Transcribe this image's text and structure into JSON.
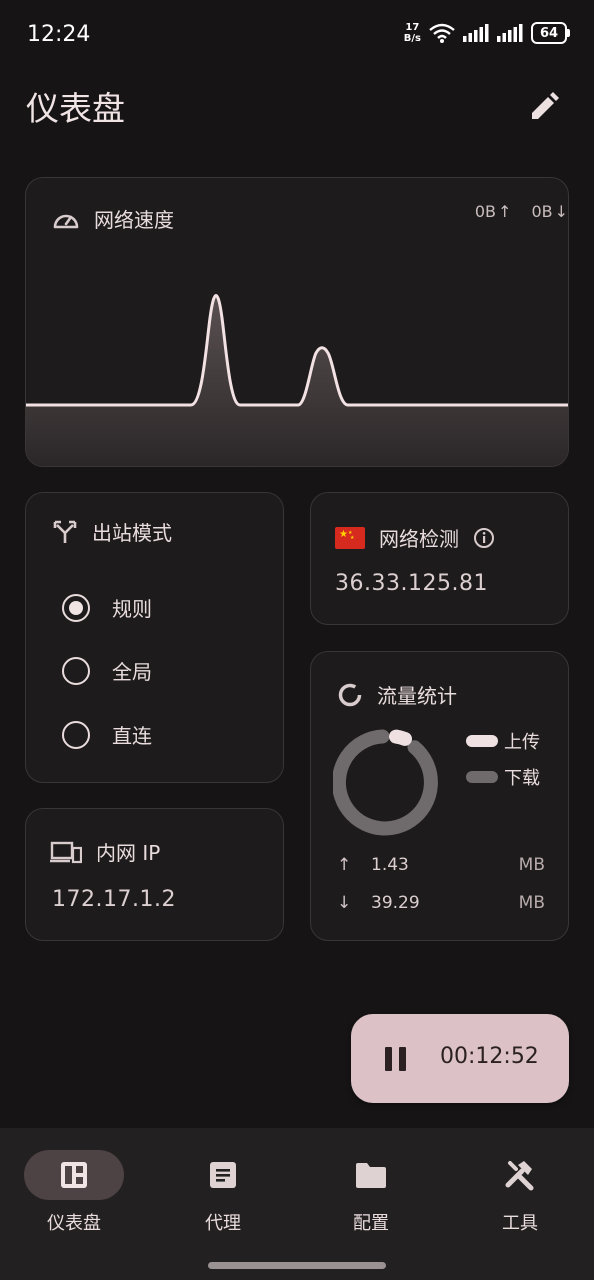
{
  "status_bar": {
    "time": "12:24",
    "net_speed_value": "17",
    "net_speed_unit": "B/s",
    "battery": "64"
  },
  "header": {
    "title": "仪表盘",
    "edit_icon": "pencil-icon"
  },
  "network_speed": {
    "title": "网络速度",
    "upload": "0B",
    "download": "0B",
    "icon": "speedometer-icon"
  },
  "outbound_mode": {
    "title": "出站模式",
    "icon": "fork-icon",
    "options": [
      {
        "label": "规则",
        "selected": true
      },
      {
        "label": "全局",
        "selected": false
      },
      {
        "label": "直连",
        "selected": false
      }
    ]
  },
  "network_check": {
    "title": "网络检测",
    "ip": "36.33.125.81",
    "flag": "china-flag-icon"
  },
  "lan_ip": {
    "title": "内网 IP",
    "ip": "172.17.1.2",
    "icon": "devices-icon"
  },
  "traffic": {
    "title": "流量统计",
    "legend_upload": "上传",
    "legend_download": "下载",
    "upload_value": "1.43",
    "upload_unit": "MB",
    "download_value": "39.29",
    "download_unit": "MB",
    "upload_color": "#efe1e2",
    "download_color": "#6f6a6b"
  },
  "timer": {
    "elapsed": "00:12:52"
  },
  "bottom_nav": {
    "items": [
      {
        "label": "仪表盘",
        "icon": "dashboard-icon",
        "active": true
      },
      {
        "label": "代理",
        "icon": "proxy-list-icon",
        "active": false
      },
      {
        "label": "配置",
        "icon": "folder-icon",
        "active": false
      },
      {
        "label": "工具",
        "icon": "tools-icon",
        "active": false
      }
    ]
  },
  "colors": {
    "background": "#161415",
    "card": "#1e1b1c",
    "accent": "#dcc2c6"
  }
}
